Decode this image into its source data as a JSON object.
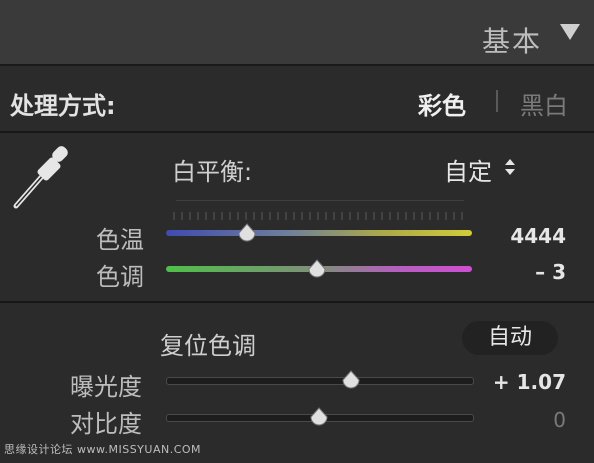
{
  "panel": {
    "title": "基本"
  },
  "treatment": {
    "label": "处理方式:",
    "color": "彩色",
    "bw": "黑白"
  },
  "white_balance": {
    "label": "白平衡:",
    "value": "自定"
  },
  "temperature": {
    "label": "色温",
    "value": "4444",
    "level": 0.265
  },
  "tint": {
    "label": "色调",
    "value": "– 3",
    "level": 0.495
  },
  "tone": {
    "label": "复位色调",
    "auto": "自动"
  },
  "exposure": {
    "label": "曝光度",
    "value": "+ 1.07",
    "level": 0.605
  },
  "contrast": {
    "label": "对比度",
    "value": "0",
    "level": 0.5
  },
  "watermark": "思缘设计论坛 www.MISSYUAN.COM",
  "colors": {
    "accent": "#e6e6e6",
    "background": "#2b2b2b",
    "header": "#3a3a3a"
  }
}
